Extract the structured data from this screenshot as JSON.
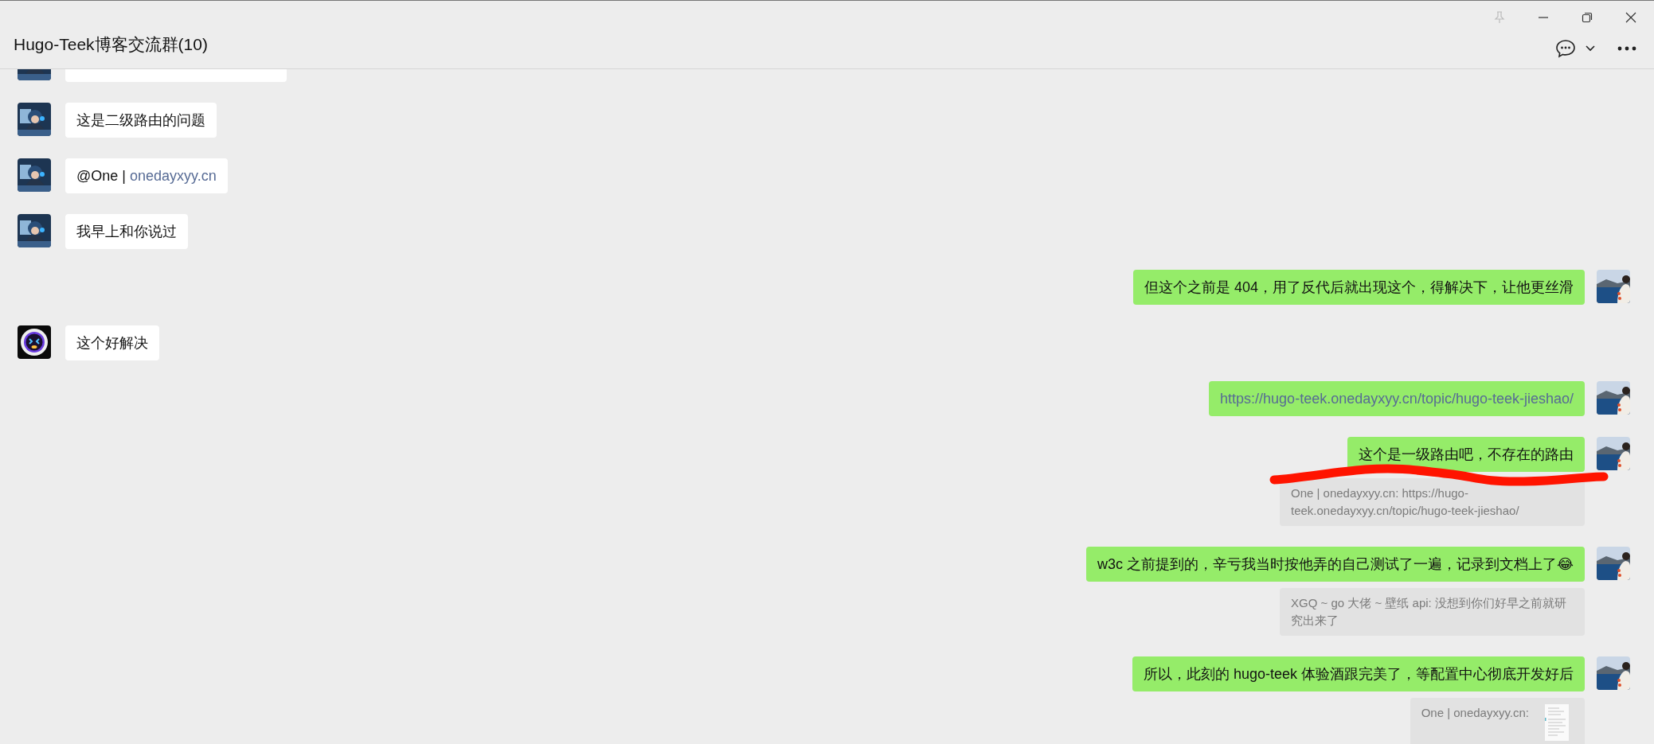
{
  "window": {
    "title": "Hugo-Teek博客交流群(10)"
  },
  "messages": [
    {
      "outgoing": false,
      "kind": "partial"
    },
    {
      "outgoing": false,
      "kind": "text",
      "text": "这是二级路由的问题"
    },
    {
      "outgoing": false,
      "kind": "mention",
      "text": "@One | ",
      "link_text": "onedayxyy.cn"
    },
    {
      "outgoing": false,
      "kind": "text",
      "text": "我早上和你说过"
    },
    {
      "outgoing": true,
      "kind": "text",
      "text": "但这个之前是 404，用了反代后就出现这个，得解决下，让他更丝滑"
    },
    {
      "outgoing": false,
      "avatar": {
        "kind": "robot"
      },
      "kind": "text",
      "text": "这个好解决"
    },
    {
      "outgoing": true,
      "kind": "link",
      "text": "https://hugo-teek.onedayxyy.cn/topic/hugo-teek-jieshao/"
    },
    {
      "outgoing": true,
      "kind": "text",
      "scribble": true,
      "text": "这个是一级路由吧，不存在的路由",
      "quote": {
        "text": "One | onedayxyy.cn: https://hugo-teek.onedayxyy.cn/topic/hugo-teek-jieshao/"
      }
    },
    {
      "outgoing": true,
      "kind": "text",
      "text": "w3c 之前提到的，辛亏我当时按他弄的自己测试了一遍，记录到文档上了😂",
      "quote": {
        "text": "XGQ ~ go 大佬 ~ 壁纸 api: 没想到你们好早之前就研究出来了"
      }
    },
    {
      "outgoing": true,
      "kind": "text",
      "text": "所以，此刻的 hugo-teek 体验酒跟完美了，等配置中心彻底开发好后",
      "quote": {
        "text": "One | onedayxyy.cn:",
        "thumbnail": true
      }
    }
  ]
}
